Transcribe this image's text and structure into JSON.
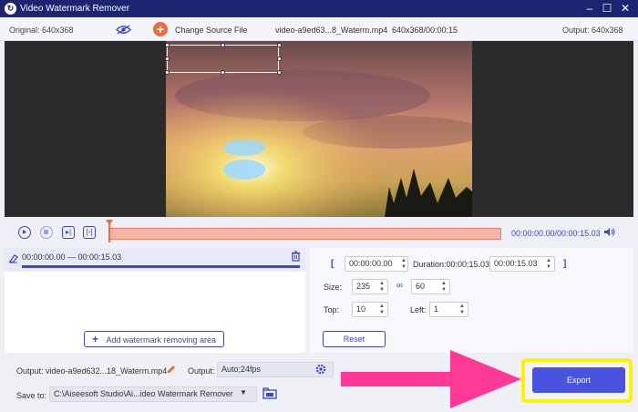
{
  "window": {
    "title": "Video Watermark Remover",
    "controls": [
      "minimize-icon",
      "maximize-icon",
      "close-icon"
    ]
  },
  "infobar": {
    "original": "Original: 640x368",
    "change_source": "Change Source File",
    "filename": "video-a9ed63...8_Waterm.mp4",
    "file_info": "640x368/00:00:15",
    "output": "Output: 640x368"
  },
  "player": {
    "timecode": "00:00:00.00/00:00:15.03"
  },
  "segment": {
    "range": "00:00:00.00 — 00:00:15.03"
  },
  "params": {
    "start": "00:00:00.00",
    "duration_label": "Duration:00:00:15.03",
    "end": "00:00:15.03",
    "size_label": "Size:",
    "width": "235",
    "height": "60",
    "top_label": "Top:",
    "top": "10",
    "left_label": "Left:",
    "left": "1",
    "reset": "Reset"
  },
  "add_area": "Add watermark removing area",
  "bottom": {
    "output_label": "Output:",
    "output_file": "video-a9ed632...18_Waterm.mp4",
    "output2_label": "Output:",
    "output_format": "Auto;24fps",
    "save_label": "Save to:",
    "save_path": "C:\\Aiseesoft Studio\\Ai...ideo Watermark Remover",
    "export": "Export"
  },
  "colors": {
    "accent": "#4a52e0",
    "title_bar": "#1d2570",
    "highlight": "#fff200",
    "arrow": "#ff2e8f"
  }
}
